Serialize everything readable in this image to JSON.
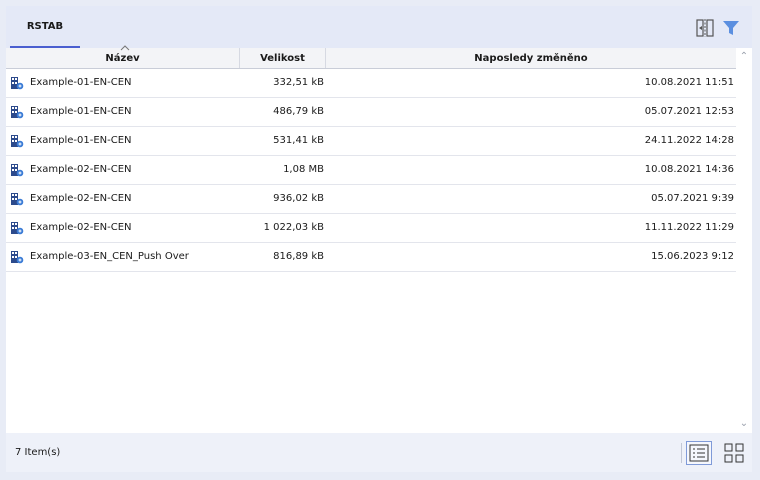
{
  "tabs": [
    {
      "label": "RSTAB",
      "active": true
    }
  ],
  "toolbar": {
    "icons": [
      "column-split-icon",
      "filter-icon"
    ],
    "accent_color": "#5b8fe0"
  },
  "table": {
    "columns": [
      "Název",
      "Velikost",
      "Naposledy změněno"
    ],
    "sorted_column": "Název",
    "rows": [
      {
        "name": "Example-01-EN-CEN",
        "size": "332,51 kB",
        "modified": "10.08.2021 11:51"
      },
      {
        "name": "Example-01-EN-CEN",
        "size": "486,79 kB",
        "modified": "05.07.2021 12:53"
      },
      {
        "name": "Example-01-EN-CEN",
        "size": "531,41 kB",
        "modified": "24.11.2022 14:28"
      },
      {
        "name": "Example-02-EN-CEN",
        "size": "1,08 MB",
        "modified": "10.08.2021 14:36"
      },
      {
        "name": "Example-02-EN-CEN",
        "size": "936,02 kB",
        "modified": "05.07.2021 9:39"
      },
      {
        "name": "Example-02-EN-CEN",
        "size": "1 022,03 kB",
        "modified": "11.11.2022 11:29"
      },
      {
        "name": "Example-03-EN_CEN_Push Over",
        "size": "816,89 kB",
        "modified": "15.06.2023 9:12"
      }
    ]
  },
  "status": {
    "item_count": "7 Item(s)"
  },
  "view_modes": {
    "active": "list",
    "options": [
      "list",
      "grid"
    ]
  }
}
